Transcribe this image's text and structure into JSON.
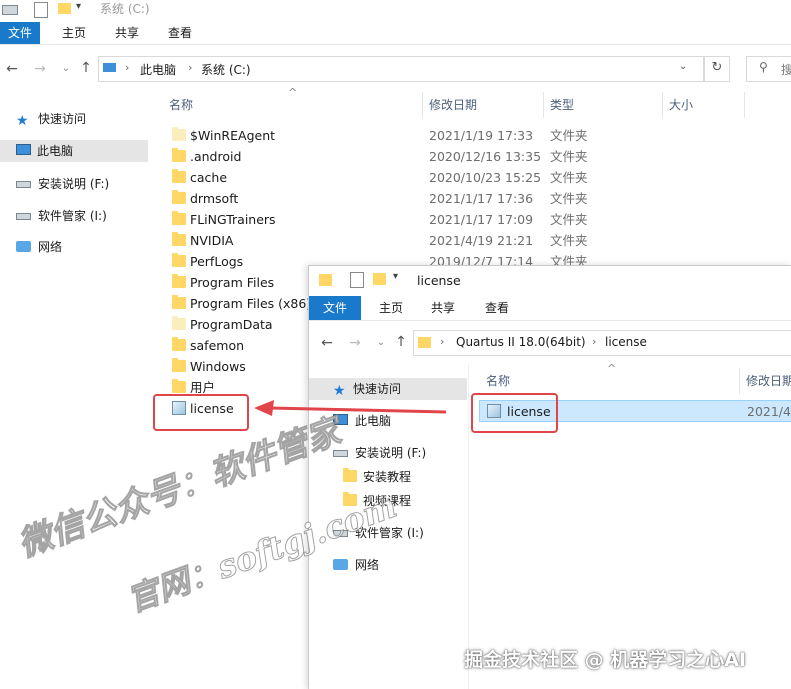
{
  "back_window": {
    "title": "系统 (C:)",
    "tabs": [
      "文件",
      "主页",
      "共享",
      "查看"
    ],
    "breadcrumb": [
      "此电脑",
      "系统 (C:)"
    ],
    "search_placeholder": "搜",
    "nav": [
      {
        "label": "快速访问",
        "icon": "star-icon"
      },
      {
        "label": "此电脑",
        "icon": "computer-icon",
        "selected": true
      },
      {
        "label": "安装说明 (F:)",
        "icon": "drive-icon"
      },
      {
        "label": "软件管家 (I:)",
        "icon": "drive-icon"
      },
      {
        "label": "网络",
        "icon": "network-icon"
      }
    ],
    "columns": [
      "名称",
      "修改日期",
      "类型",
      "大小"
    ],
    "rows": [
      {
        "name": "$WinREAgent",
        "date": "2021/1/19 17:33",
        "type": "文件夹",
        "pale": true
      },
      {
        "name": ".android",
        "date": "2020/12/16 13:35",
        "type": "文件夹"
      },
      {
        "name": "cache",
        "date": "2020/10/23 15:25",
        "type": "文件夹"
      },
      {
        "name": "drmsoft",
        "date": "2021/1/17 17:36",
        "type": "文件夹"
      },
      {
        "name": "FLiNGTrainers",
        "date": "2021/1/17 17:09",
        "type": "文件夹"
      },
      {
        "name": "NVIDIA",
        "date": "2021/4/19 21:21",
        "type": "文件夹"
      },
      {
        "name": "PerfLogs",
        "date": "2019/12/7 17:14",
        "type": "文件夹"
      },
      {
        "name": "Program Files",
        "date": "",
        "type": ""
      },
      {
        "name": "Program Files (x86)",
        "date": "",
        "type": ""
      },
      {
        "name": "ProgramData",
        "date": "",
        "type": "",
        "pale": true
      },
      {
        "name": "safemon",
        "date": "",
        "type": ""
      },
      {
        "name": "Windows",
        "date": "",
        "type": ""
      },
      {
        "name": "用户",
        "date": "",
        "type": ""
      },
      {
        "name": "license",
        "date": "",
        "type": "",
        "file": true
      }
    ]
  },
  "front_window": {
    "title": "license",
    "tabs": [
      "文件",
      "主页",
      "共享",
      "查看"
    ],
    "breadcrumb": [
      "Quartus II 18.0(64bit)",
      "license"
    ],
    "nav": [
      {
        "label": "快速访问",
        "icon": "star-icon",
        "selected": true
      },
      {
        "label": "此电脑",
        "icon": "computer-icon"
      },
      {
        "label": "安装说明 (F:)",
        "icon": "drive-icon"
      },
      {
        "label": "安装教程",
        "icon": "folder-icon",
        "indent": true
      },
      {
        "label": "视频课程",
        "icon": "folder-icon",
        "indent": true
      },
      {
        "label": "软件管家 (I:)",
        "icon": "drive-icon"
      },
      {
        "label": "网络",
        "icon": "network-icon"
      }
    ],
    "columns": [
      "名称",
      "修改日期"
    ],
    "rows": [
      {
        "name": "license",
        "date": "2021/4/",
        "file": true,
        "selected": true
      }
    ]
  },
  "watermark": {
    "line1": "微信公众号：软件管家",
    "line2": "官网：softgj.com"
  },
  "credit": "掘金技术社区 @ 机器学习之心AI",
  "colors": {
    "accent": "#1979ca",
    "selection": "#cce8ff",
    "highlight_red": "#e0454a"
  }
}
